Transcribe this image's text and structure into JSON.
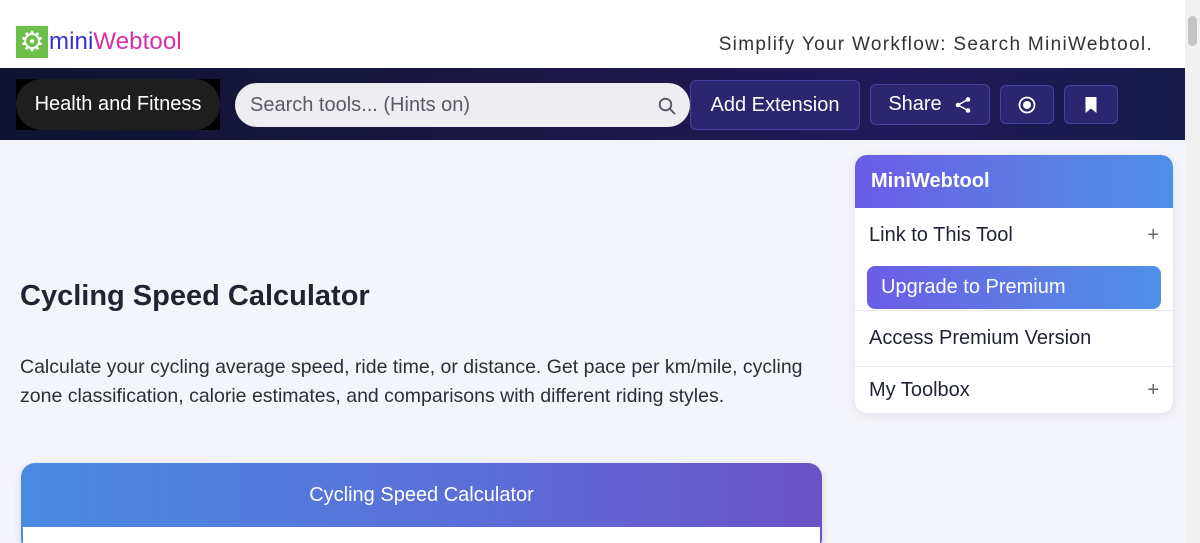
{
  "header": {
    "logo_mini": "mini",
    "logo_web": "Webtool",
    "logo_icon": "gear-icon",
    "tagline": "Simplify Your Workflow: Search MiniWebtool."
  },
  "nav": {
    "category": "Health and Fitness",
    "search_placeholder": "Search tools... (Hints on)",
    "add_extension": "Add Extension",
    "share": "Share",
    "icons": [
      "search-icon",
      "share-icon",
      "record-icon",
      "bookmark-icon"
    ]
  },
  "main": {
    "title": "Cycling Speed Calculator",
    "description": "Calculate your cycling average speed, ride time, or distance. Get pace per km/mile, cycling zone classification, calorie estimates, and comparisons with different riding styles.",
    "calculator_title": "Cycling Speed Calculator"
  },
  "sidebar": {
    "title": "MiniWebtool",
    "link_to_tool": "Link to This Tool",
    "upgrade": "Upgrade to Premium",
    "access_premium": "Access Premium Version",
    "my_toolbox": "My Toolbox",
    "expand_symbol": "+"
  },
  "colors": {
    "logo_green": "#6cc04a",
    "logo_blue": "#3a2fd6",
    "logo_magenta": "#d62fa8",
    "nav_dark": "#1b1745",
    "button_purple": "#2c2570",
    "gradient_purple": "#6b5ce7",
    "gradient_blue": "#4d8fe6"
  }
}
